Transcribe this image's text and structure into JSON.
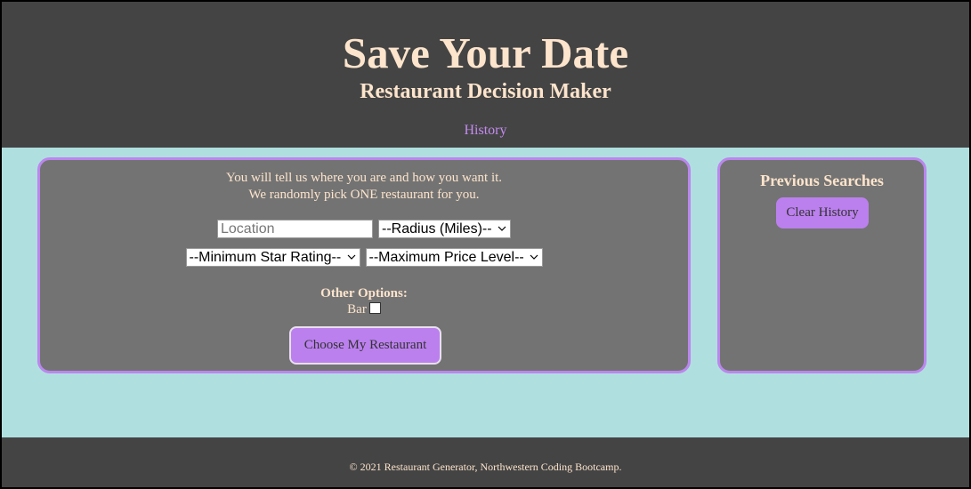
{
  "header": {
    "title": "Save Your Date",
    "subtitle": "Restaurant Decision Maker",
    "nav_history": "History"
  },
  "search": {
    "intro_line1": "You will tell us where you are and how you want it.",
    "intro_line2": "We randomly pick ONE restaurant for you.",
    "location_placeholder": "Location",
    "radius_selected": "--Radius (Miles)--",
    "rating_selected": "--Minimum Star Rating--",
    "price_selected": "--Maximum Price Level--",
    "other_options_label": "Other Options:",
    "bar_label": "Bar",
    "bar_checked": false,
    "choose_button": "Choose My Restaurant"
  },
  "history": {
    "title": "Previous Searches",
    "clear_button": "Clear History"
  },
  "footer": {
    "copyright": "© 2021 Restaurant Generator, Northwestern Coding Bootcamp."
  },
  "colors": {
    "page_background": "#b0dfdf",
    "header_background": "#444444",
    "panel_background": "#737373",
    "panel_border": "#bb86ee",
    "button_background": "#bb80ee",
    "text_cream": "#fde4cc",
    "link_purple": "#c58cf0"
  },
  "icons": {
    "select_arrow": "chevron-down-icon"
  }
}
